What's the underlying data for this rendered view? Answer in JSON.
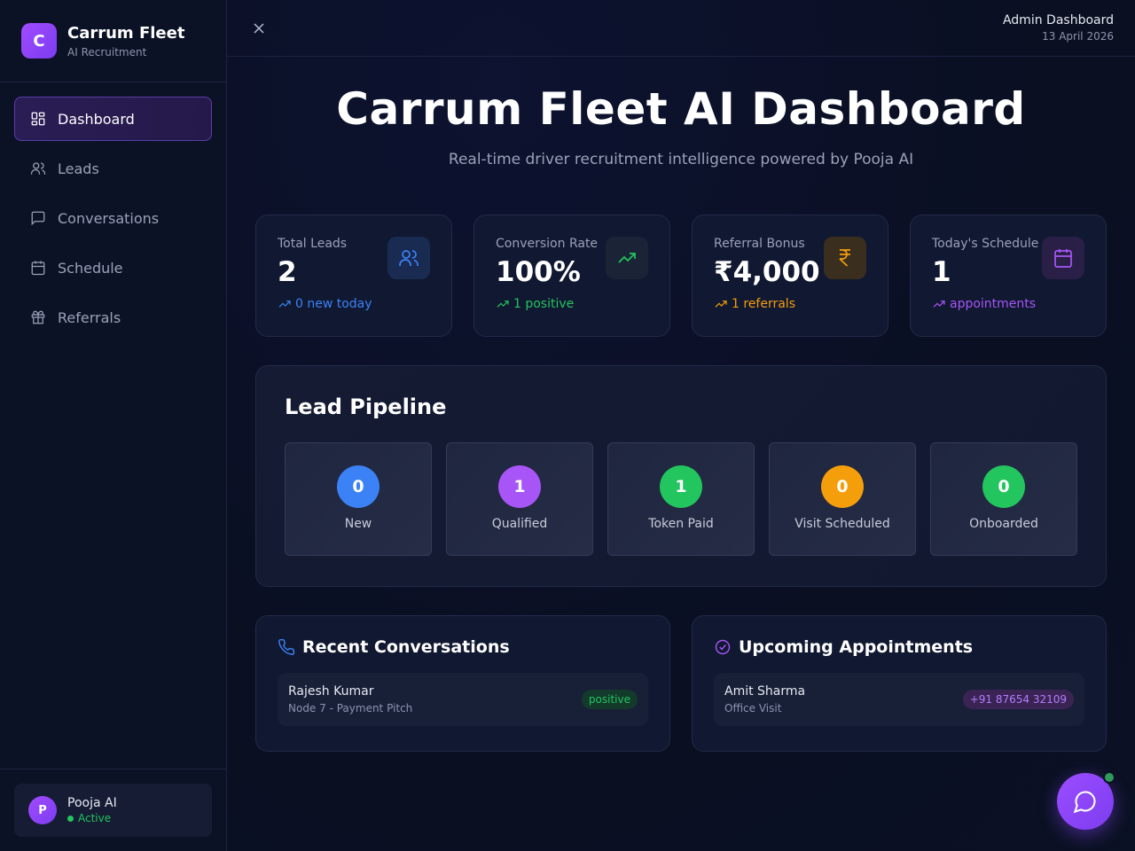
{
  "brand": {
    "logo_letter": "C",
    "name": "Carrum Fleet",
    "subtitle": "AI Recruitment"
  },
  "sidebar": {
    "items": [
      {
        "label": "Dashboard",
        "icon": "dashboard-icon",
        "active": true
      },
      {
        "label": "Leads",
        "icon": "users-icon"
      },
      {
        "label": "Conversations",
        "icon": "message-icon"
      },
      {
        "label": "Schedule",
        "icon": "calendar-icon"
      },
      {
        "label": "Referrals",
        "icon": "gift-icon"
      }
    ],
    "user": {
      "avatar_letter": "P",
      "name": "Pooja AI",
      "status": "Active"
    }
  },
  "topbar": {
    "title": "Admin Dashboard",
    "date": "13 April 2026"
  },
  "hero": {
    "title": "Carrum Fleet AI Dashboard",
    "subtitle": "Real-time driver recruitment intelligence powered by Pooja AI"
  },
  "stats": [
    {
      "label": "Total Leads",
      "value": "2",
      "trend": "0 new today",
      "color": "#3b82f6",
      "icon": "users-icon"
    },
    {
      "label": "Conversion Rate",
      "value": "100%",
      "trend": "1 positive",
      "color": "#22c55e",
      "icon": "trending-up-icon"
    },
    {
      "label": "Referral Bonus",
      "value": "₹4,000",
      "trend": "1 referrals",
      "color": "#f59e0b",
      "icon": "rupee-icon"
    },
    {
      "label": "Today's Schedule",
      "value": "1",
      "trend": "appointments",
      "color": "#a855f7",
      "icon": "calendar-icon"
    }
  ],
  "pipeline": {
    "title": "Lead Pipeline",
    "stages": [
      {
        "count": "0",
        "label": "New",
        "color": "#3b82f6"
      },
      {
        "count": "1",
        "label": "Qualified",
        "color": "#a855f7"
      },
      {
        "count": "1",
        "label": "Token Paid",
        "color": "#22c55e"
      },
      {
        "count": "0",
        "label": "Visit Scheduled",
        "color": "#f59e0b"
      },
      {
        "count": "0",
        "label": "Onboarded",
        "color": "#22c55e"
      }
    ]
  },
  "conversations": {
    "title": "Recent Conversations",
    "items": [
      {
        "name": "Rajesh Kumar",
        "detail": "Node 7 - Payment Pitch",
        "badge": "positive"
      }
    ]
  },
  "appointments": {
    "title": "Upcoming Appointments",
    "items": [
      {
        "name": "Amit Sharma",
        "detail": "Office Visit",
        "badge": "+91 87654 32109"
      }
    ]
  }
}
